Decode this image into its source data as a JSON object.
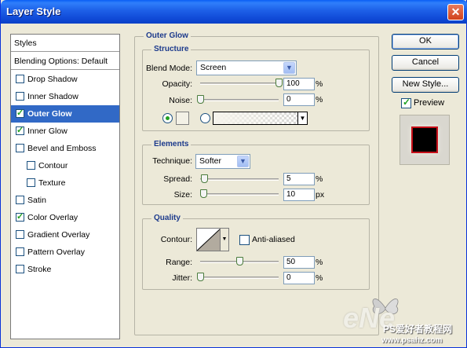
{
  "window": {
    "title": "Layer Style",
    "close_symbol": "✕"
  },
  "styles_panel": {
    "header": "Styles",
    "blending": "Blending Options: Default",
    "items": [
      {
        "label": "Drop Shadow",
        "checked": false
      },
      {
        "label": "Inner Shadow",
        "checked": false
      },
      {
        "label": "Outer Glow",
        "checked": true,
        "selected": true
      },
      {
        "label": "Inner Glow",
        "checked": true
      },
      {
        "label": "Bevel and Emboss",
        "checked": false
      },
      {
        "label": "Contour",
        "checked": false,
        "sub": true
      },
      {
        "label": "Texture",
        "checked": false,
        "sub": true
      },
      {
        "label": "Satin",
        "checked": false
      },
      {
        "label": "Color Overlay",
        "checked": true
      },
      {
        "label": "Gradient Overlay",
        "checked": false
      },
      {
        "label": "Pattern Overlay",
        "checked": false
      },
      {
        "label": "Stroke",
        "checked": false
      }
    ]
  },
  "outer_glow": {
    "title": "Outer Glow",
    "structure": {
      "title": "Structure",
      "blend_mode_label": "Blend Mode:",
      "blend_mode_value": "Screen",
      "opacity_label": "Opacity:",
      "opacity_value": "100",
      "opacity_pct": 100,
      "noise_label": "Noise:",
      "noise_value": "0",
      "noise_pct": 0,
      "unit_pct": "%"
    },
    "elements": {
      "title": "Elements",
      "technique_label": "Technique:",
      "technique_value": "Softer",
      "spread_label": "Spread:",
      "spread_value": "5",
      "spread_pct": 5,
      "size_label": "Size:",
      "size_value": "10",
      "size_pct": 4,
      "unit_pct": "%",
      "unit_px": "px"
    },
    "quality": {
      "title": "Quality",
      "contour_label": "Contour:",
      "anti_aliased_label": "Anti-aliased",
      "range_label": "Range:",
      "range_value": "50",
      "range_pct": 50,
      "jitter_label": "Jitter:",
      "jitter_value": "0",
      "jitter_pct": 0,
      "unit_pct": "%"
    }
  },
  "buttons": {
    "ok": "OK",
    "cancel": "Cancel",
    "new_style": "New Style...",
    "preview": "Preview"
  },
  "watermark": {
    "brand": "PS爱好者教程网",
    "url": "www.psahz.com",
    "logo_text": "eNe"
  },
  "colors": {
    "selection": "#3169c6",
    "glow_color": "#f3f1e6",
    "preview_border": "#c8101a"
  }
}
